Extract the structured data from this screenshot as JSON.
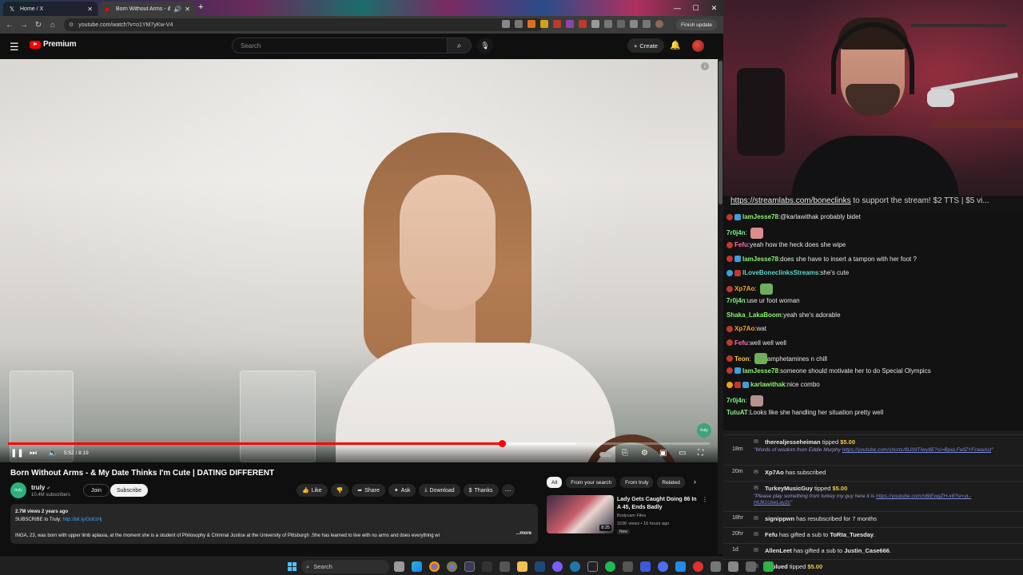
{
  "browser": {
    "tabs": [
      {
        "title": "Home / X",
        "icon": "x-logo-icon"
      },
      {
        "title": "Born Without Arms - & My",
        "icon": "youtube-icon",
        "active": true
      }
    ],
    "url": "youtube.com/watch?v=o1YM7yKw-V4",
    "finish_update": "Finish update"
  },
  "youtube": {
    "brand": "Premium",
    "search_placeholder": "Search",
    "create_label": "Create",
    "player": {
      "time": "5:52 / 8:19",
      "progress_fraction": 0.704,
      "buffer_fraction": 0.81,
      "watermark": "truly"
    },
    "video_title": "Born Without Arms - & My Date Thinks I'm Cute | DATING DIFFERENT",
    "channel": {
      "name": "truly",
      "subscribers": "10.4M subscribers",
      "avatar_text": "truly"
    },
    "join_label": "Join",
    "subscribe_label": "Subscribe",
    "actions": [
      {
        "label": "Like",
        "icon": "thumbs-up-icon"
      },
      {
        "label": "",
        "icon": "thumbs-down-icon"
      },
      {
        "label": "Share",
        "icon": "share-icon"
      },
      {
        "label": "Ask",
        "icon": "sparkle-icon"
      },
      {
        "label": "Download",
        "icon": "download-icon"
      },
      {
        "label": "Thanks",
        "icon": "thanks-icon"
      }
    ],
    "description": {
      "stats": "2.7M views  2 years ago",
      "subscribe_line": "SUBSCRIBE to Truly: ",
      "subscribe_link": "http://bit.ly/Oc61Hj",
      "body": "INGA, 23, was born with upper limb aplasia, at the moment she is a student of Philosophy & Criminal Justice at the University of  Pittsburgh .She has learned to live with no arms and does everything wi",
      "more": "...more"
    },
    "filter_chips": [
      "All",
      "From your search",
      "From truly",
      "Related"
    ],
    "recommendation": {
      "title": "Lady Gets Caught Doing 86 In A 45, Ends Badly",
      "channel": "Bodycam Files",
      "meta": "163K views • 16 hours ago",
      "badge": "New",
      "duration": "8:25"
    }
  },
  "stream": {
    "ticker_link": "https://streamlabs.com/boneclinks",
    "ticker_text": " to support the stream! $2 TTS | $5 vi..."
  },
  "chat": [
    {
      "user": "IamJesse78",
      "color": "#8cf56e",
      "badges": [
        "#c0392b",
        "#3aa0e0"
      ],
      "text": " @karlawithak probably bidet"
    },
    {
      "user": "7r0j4n",
      "color": "#7df38a",
      "badges": [],
      "text": "",
      "emote": "#d98d8d"
    },
    {
      "user": "Fefu",
      "color": "#ff6fae",
      "badges": [
        "#c0392b"
      ],
      "text": " yeah how the heck does she wipe"
    },
    {
      "user": "IamJesse78",
      "color": "#8cf56e",
      "badges": [
        "#c0392b",
        "#3aa0e0"
      ],
      "text": " does she have to insert a tampon with her foot ?"
    },
    {
      "user": "ILoveBoneclinksStreams",
      "color": "#5fd6c7",
      "badges": [
        "#3aa0e0",
        "#c0392b"
      ],
      "text": " she's cute"
    },
    {
      "user": "Xp7Ao",
      "color": "#f5a623",
      "badges": [
        "#c0392b"
      ],
      "text": "",
      "emote": "#6fae5a"
    },
    {
      "user": "7r0j4n",
      "color": "#7df38a",
      "badges": [],
      "text": " use ur foot woman"
    },
    {
      "user": "Shaka_LakaBoom",
      "color": "#8cf56e",
      "badges": [],
      "text": " yeah she's adorable"
    },
    {
      "user": "Xp7Ao",
      "color": "#f5a623",
      "badges": [
        "#c0392b"
      ],
      "text": " wat"
    },
    {
      "user": "Fefu",
      "color": "#ff6fae",
      "badges": [
        "#c0392b"
      ],
      "text": " well well well"
    },
    {
      "user": "Teon",
      "color": "#f2c94c",
      "badges": [
        "#c0392b"
      ],
      "text": " amphetamines n chill",
      "emote_before": "#6fae5a"
    },
    {
      "user": "IamJesse78",
      "color": "#8cf56e",
      "badges": [
        "#c0392b",
        "#3aa0e0"
      ],
      "text": " someone should motivate her to do Special Olympics"
    },
    {
      "user": "karlawithak",
      "color": "#8cf56e",
      "badges": [
        "#f2a20c",
        "#c0392b",
        "#3aa0e0"
      ],
      "text": " nice combo"
    },
    {
      "user": "7r0j4n",
      "color": "#7df38a",
      "badges": [],
      "text": "",
      "emote": "#b59090"
    },
    {
      "user": "TutuAT",
      "color": "#7df38a",
      "badges": [],
      "text": " Looks like she handling her situation pretty well"
    }
  ],
  "alerts": [
    {
      "time": "18m",
      "user": "therealjesseheiman",
      "action": " tipped ",
      "amount": "$5.00",
      "sub_text": "\"Words of wisdom from Eddie Murphy ",
      "sub_link": "https://youtube.com/shorts/f8J09TIwy8E?si=BpeLFwfZYFcwaAst",
      "sub_tail": "\""
    },
    {
      "time": "20m",
      "user": "Xp7Ao",
      "action": " has subscribed",
      "amount": ""
    },
    {
      "time": "",
      "user": "TurkeyMusicGuy",
      "action": " tipped ",
      "amount": "$5.00",
      "sub_text": "\"Please play something from turkey my guy here it is ",
      "sub_link": "https://youtube.com/nBiEwgZH-x8?si=yL-HtJ61UxeLay2c",
      "sub_tail": "\""
    },
    {
      "time": "18hr",
      "user": "signippwn",
      "action": " has resubscribed for 7 months",
      "amount": ""
    },
    {
      "time": "20hr",
      "user": "Fefu",
      "action": " has gifted a sub to ",
      "amount": "",
      "target": "ToRta_Tuesday",
      "tail": "."
    },
    {
      "time": "1d",
      "user": "AllenLeet",
      "action": " has gifted a sub to ",
      "amount": "",
      "target": "Justin_Case666",
      "tail": "."
    },
    {
      "time": "1d",
      "user": "cnblued",
      "action": " tipped ",
      "amount": "$5.00"
    }
  ],
  "taskbar": {
    "search_label": "Search"
  }
}
